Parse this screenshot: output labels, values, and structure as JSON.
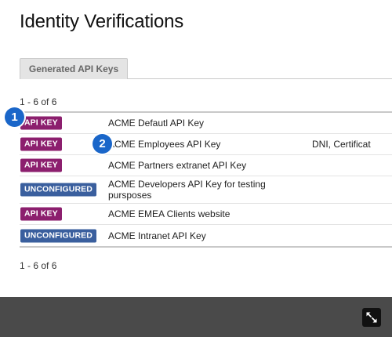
{
  "page": {
    "title": "Identity Verifications"
  },
  "tabs": [
    {
      "label": "Generated API Keys"
    }
  ],
  "pagination": {
    "top": "1 - 6 of 6",
    "bottom": "1 - 6 of 6"
  },
  "rows": [
    {
      "badge": "API KEY",
      "badge_type": "apikey",
      "name": "ACME Defautl API Key",
      "extra": ""
    },
    {
      "badge": "API KEY",
      "badge_type": "apikey",
      "name": "ACME Employees API Key",
      "extra": "DNI, Certificat"
    },
    {
      "badge": "API KEY",
      "badge_type": "apikey",
      "name": "ACME Partners extranet API Key",
      "extra": ""
    },
    {
      "badge": "UNCONFIGURED",
      "badge_type": "unconfigured",
      "name": "ACME Developers API Key for testing pursposes",
      "extra": ""
    },
    {
      "badge": "API KEY",
      "badge_type": "apikey",
      "name": "ACME EMEA Clients website",
      "extra": ""
    },
    {
      "badge": "UNCONFIGURED",
      "badge_type": "unconfigured",
      "name": "ACME Intranet API Key",
      "extra": ""
    }
  ],
  "callouts": {
    "one": "1",
    "two": "2"
  },
  "footer": {
    "fullscreen_icon": "expand-icon"
  },
  "colors": {
    "api_key_badge": "#8c1f6e",
    "unconfigured_badge": "#3a5f9e",
    "callout": "#1a66c9",
    "footer": "#4a4a4a"
  }
}
